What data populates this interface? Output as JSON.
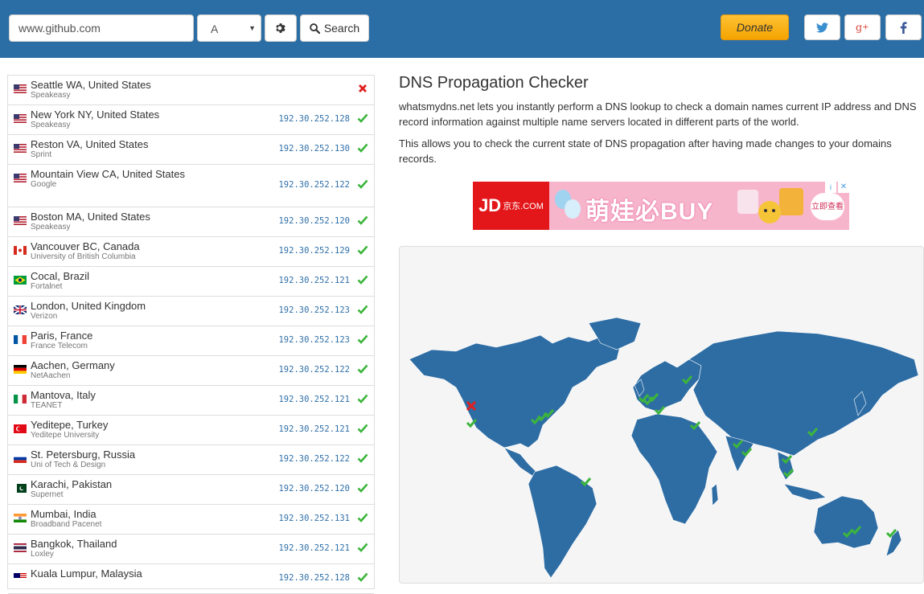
{
  "header": {
    "domain_value": "www.github.com",
    "record_type": "A",
    "search_label": "Search",
    "donate_label": "Donate"
  },
  "page": {
    "title": "DNS Propagation Checker",
    "intro": "whatsmydns.net lets you instantly perform a DNS lookup to check a domain names current IP address and DNS record information against multiple name servers located in different parts of the world.",
    "intro2": "This allows you to check the current state of DNS propagation after having made changes to your domains records."
  },
  "ad": {
    "logo": "JD",
    "logo_sub": "京东.COM",
    "text": "萌娃必BUY",
    "cta": "立即查看"
  },
  "results": [
    {
      "location": "Seattle WA, United States",
      "provider": "Speakeasy",
      "ip": "",
      "status": "fail",
      "flag": "us"
    },
    {
      "location": "New York NY, United States",
      "provider": "Speakeasy",
      "ip": "192.30.252.128",
      "status": "ok",
      "flag": "us"
    },
    {
      "location": "Reston VA, United States",
      "provider": "Sprint",
      "ip": "192.30.252.130",
      "status": "ok",
      "flag": "us"
    },
    {
      "location": "Mountain View CA, United States",
      "provider": "Google",
      "ip": "192.30.252.122",
      "status": "ok",
      "flag": "us"
    },
    {
      "location": "Boston MA, United States",
      "provider": "Speakeasy",
      "ip": "192.30.252.120",
      "status": "ok",
      "flag": "us"
    },
    {
      "location": "Vancouver BC, Canada",
      "provider": "University of British Columbia",
      "ip": "192.30.252.129",
      "status": "ok",
      "flag": "ca"
    },
    {
      "location": "Cocal, Brazil",
      "provider": "Fortalnet",
      "ip": "192.30.252.121",
      "status": "ok",
      "flag": "br"
    },
    {
      "location": "London, United Kingdom",
      "provider": "Verizon",
      "ip": "192.30.252.123",
      "status": "ok",
      "flag": "gb"
    },
    {
      "location": "Paris, France",
      "provider": "France Telecom",
      "ip": "192.30.252.123",
      "status": "ok",
      "flag": "fr"
    },
    {
      "location": "Aachen, Germany",
      "provider": "NetAachen",
      "ip": "192.30.252.122",
      "status": "ok",
      "flag": "de"
    },
    {
      "location": "Mantova, Italy",
      "provider": "TEANET",
      "ip": "192.30.252.121",
      "status": "ok",
      "flag": "it"
    },
    {
      "location": "Yeditepe, Turkey",
      "provider": "Yeditepe University",
      "ip": "192.30.252.121",
      "status": "ok",
      "flag": "tr"
    },
    {
      "location": "St. Petersburg, Russia",
      "provider": "Uni of Tech & Design",
      "ip": "192.30.252.122",
      "status": "ok",
      "flag": "ru"
    },
    {
      "location": "Karachi, Pakistan",
      "provider": "Supernet",
      "ip": "192.30.252.120",
      "status": "ok",
      "flag": "pk"
    },
    {
      "location": "Mumbai, India",
      "provider": "Broadband Pacenet",
      "ip": "192.30.252.131",
      "status": "ok",
      "flag": "in"
    },
    {
      "location": "Bangkok, Thailand",
      "provider": "Loxley",
      "ip": "192.30.252.121",
      "status": "ok",
      "flag": "th"
    },
    {
      "location": "Kuala Lumpur, Malaysia",
      "provider": "",
      "ip": "192.30.252.128",
      "status": "ok",
      "flag": "my"
    }
  ],
  "colors": {
    "header_bg": "#2b6ea5",
    "map_land": "#2e6da4",
    "ok": "#3cb53c",
    "fail": "#e02020"
  }
}
